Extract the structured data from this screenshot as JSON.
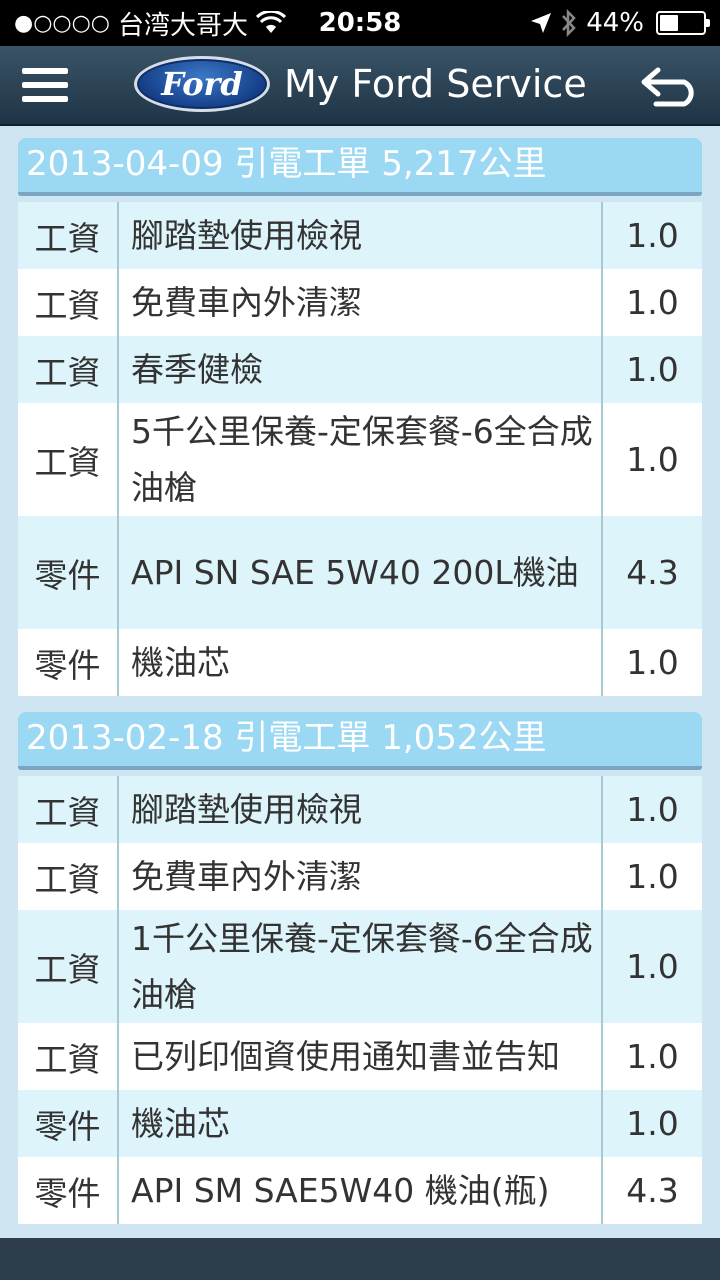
{
  "status": {
    "signal": "●○○○○",
    "carrier": "台湾大哥大",
    "time": "20:58",
    "battery": "44%",
    "battery_level": 0.44
  },
  "nav": {
    "logo_text": "Ford",
    "title": "My Ford Service"
  },
  "sections": [
    {
      "header": "2013-04-09 引電工單 5,217公里",
      "rows": [
        {
          "type": "工資",
          "desc": "腳踏墊使用檢視",
          "qty": "1.0"
        },
        {
          "type": "工資",
          "desc": "免費車內外清潔",
          "qty": "1.0"
        },
        {
          "type": "工資",
          "desc": "春季健檢",
          "qty": "1.0"
        },
        {
          "type": "工資",
          "desc": "5千公里保養-定保套餐-6全合成油槍",
          "qty": "1.0"
        },
        {
          "type": "零件",
          "desc": "API SN SAE 5W40 200L機油",
          "qty": "4.3"
        },
        {
          "type": "零件",
          "desc": "機油芯",
          "qty": "1.0"
        }
      ]
    },
    {
      "header": "2013-02-18 引電工單 1,052公里",
      "rows": [
        {
          "type": "工資",
          "desc": "腳踏墊使用檢視",
          "qty": "1.0"
        },
        {
          "type": "工資",
          "desc": "免費車內外清潔",
          "qty": "1.0"
        },
        {
          "type": "工資",
          "desc": "1千公里保養-定保套餐-6全合成油槍",
          "qty": "1.0"
        },
        {
          "type": "工資",
          "desc": "已列印個資使用通知書並告知",
          "qty": "1.0"
        },
        {
          "type": "零件",
          "desc": "機油芯",
          "qty": "1.0"
        },
        {
          "type": "零件",
          "desc": "API SM SAE5W40 機油(瓶)",
          "qty": "4.3"
        }
      ]
    }
  ]
}
